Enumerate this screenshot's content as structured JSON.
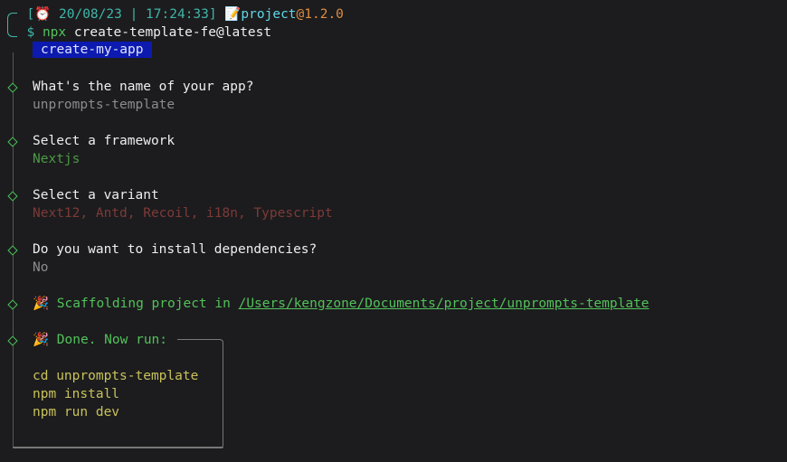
{
  "prompt": {
    "date": "20/08/23",
    "separator": "|",
    "time": "17:24:33",
    "project": "project",
    "version": "@1.2.0",
    "dollar": "$",
    "command_bin": "npx",
    "command_args": "create-template-fe@latest"
  },
  "banner": "create-my-app",
  "steps": [
    {
      "question": "What's the name of your app?",
      "answer": "unprompts-template"
    },
    {
      "question": "Select a framework",
      "answer": "Nextjs"
    },
    {
      "question": "Select a variant",
      "answer": "Next12, Antd, Recoil, i18n, Typescript"
    },
    {
      "question": "Do you want to install dependencies?",
      "answer": "No"
    }
  ],
  "scaffold": {
    "text": "Scaffolding project in",
    "path": "/Users/kengzone/Documents/project/unprompts-template"
  },
  "done": {
    "text": "Done. Now run:",
    "commands": [
      "cd unprompts-template",
      "npm install",
      "npm run dev"
    ]
  },
  "icons": {
    "clock": "alarm-clock-icon",
    "memo": "memo-icon",
    "party": "party-popper-icon"
  },
  "colors": {
    "background": "#1c1c1e",
    "teal": "#3fb6a8",
    "green": "#52c25a",
    "orange": "#e08a3c",
    "badge": "#0c1ab0",
    "yellow": "#c9c25a"
  }
}
